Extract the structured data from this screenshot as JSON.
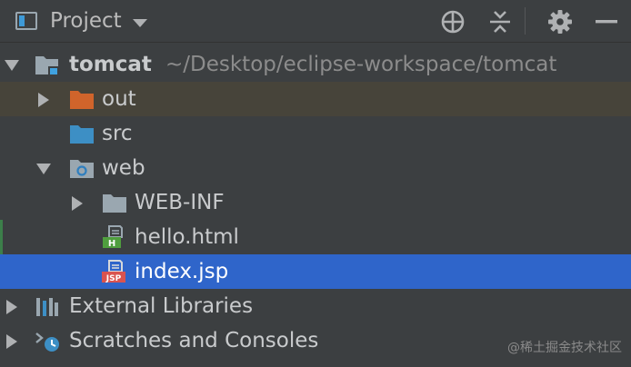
{
  "header": {
    "title": "Project",
    "icons": {
      "view": "project-view-icon",
      "dropdown": "chevron-down-icon",
      "locate": "crosshair-icon",
      "collapse": "collapse-all-icon",
      "settings": "gear-icon",
      "hide": "minimize-icon"
    }
  },
  "tree": {
    "root": {
      "name": "tomcat",
      "path": "~/Desktop/eclipse-workspace/tomcat"
    },
    "out": {
      "name": "out"
    },
    "src": {
      "name": "src"
    },
    "web": {
      "name": "web"
    },
    "webinf": {
      "name": "WEB-INF"
    },
    "hello": {
      "name": "hello.html",
      "badge": "H"
    },
    "index": {
      "name": "index.jsp",
      "badge": "JSP"
    },
    "libraries": {
      "name": "External Libraries"
    },
    "scratches": {
      "name": "Scratches and Consoles"
    }
  },
  "watermark": "@稀土掘金技术社区",
  "colors": {
    "background": "#3c3f41",
    "selection": "#2f65ca",
    "folder_excluded": "#d0642b",
    "folder_source": "#3d8fc5",
    "folder_plain": "#9aa7b0"
  }
}
